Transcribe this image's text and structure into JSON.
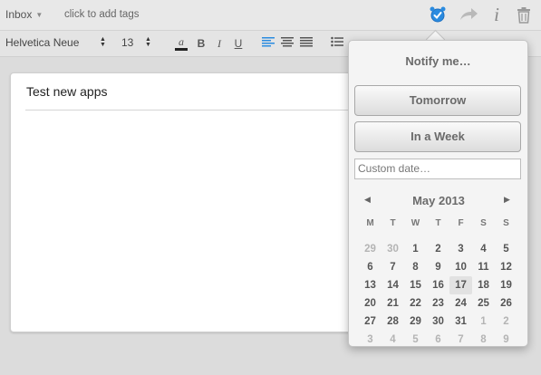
{
  "toolbar": {
    "notebook": "Inbox",
    "tags_placeholder": "click to add tags"
  },
  "format_bar": {
    "font": "Helvetica Neue",
    "size": "13",
    "buttons": [
      "a",
      "B",
      "I",
      "U"
    ]
  },
  "note": {
    "title": "Test new apps"
  },
  "reminder": {
    "title": "Notify me…",
    "tomorrow": "Tomorrow",
    "week": "In a Week",
    "custom_placeholder": "Custom date…",
    "calendar": {
      "month": "May 2013",
      "weekdays": [
        "M",
        "T",
        "W",
        "T",
        "F",
        "S",
        "S"
      ],
      "weeks": [
        [
          "29",
          "30",
          "1",
          "2",
          "3",
          "4",
          "5"
        ],
        [
          "6",
          "7",
          "8",
          "9",
          "10",
          "11",
          "12"
        ],
        [
          "13",
          "14",
          "15",
          "16",
          "17",
          "18",
          "19"
        ],
        [
          "20",
          "21",
          "22",
          "23",
          "24",
          "25",
          "26"
        ],
        [
          "27",
          "28",
          "29",
          "30",
          "31",
          "1",
          "2"
        ],
        [
          "3",
          "4",
          "5",
          "6",
          "7",
          "8",
          "9"
        ]
      ],
      "selected_day": "17"
    }
  },
  "colors": {
    "accent": "#2a8be0"
  }
}
